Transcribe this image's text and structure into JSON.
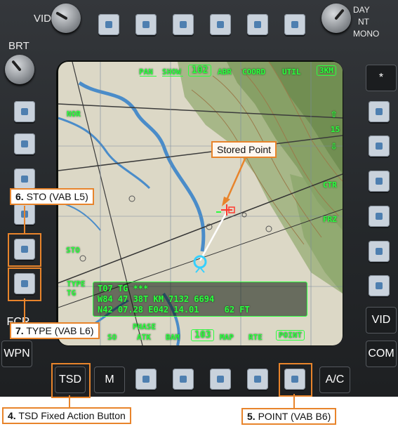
{
  "top_knobs": {
    "vid_label": "VID",
    "brt_label": "BRT",
    "day_label": "DAY",
    "nt_label": "NT",
    "mono_label": "MONO"
  },
  "top_labels": {
    "pan": "PAN",
    "show": "SHOW",
    "page_no": "102",
    "abr": "ABR",
    "coord": "COORD",
    "util": "UTIL",
    "scale": "3KM"
  },
  "right_labels": {
    "ctr": "CTR",
    "frz": "FRZ",
    "zoom_level": "15"
  },
  "left_labels": {
    "nor": "NOR",
    "sto": "STO",
    "type_line1": "TYPE",
    "type_line2": "TG"
  },
  "bottom_labels": {
    "so": "SO",
    "phase": "PHASE",
    "atk": "ATK",
    "bam": "BAM",
    "page_no": "103",
    "map": "MAP",
    "rte": "RTE",
    "point": "POINT"
  },
  "data_block": {
    "line1": "T07 TG ***",
    "line2": "W84 47 38T KM 7132 6694",
    "line3": "N42 07.28 E042 14.01     62 FT"
  },
  "fixed_buttons": {
    "star": "*",
    "vid": "VID",
    "com": "COM",
    "ac": "A/C",
    "tsd": "TSD",
    "m": "M",
    "fcr": "FCR",
    "wpn": "WPN"
  },
  "callouts": {
    "stored_point": "Stored Point",
    "sto_num": "6.",
    "sto_text": "STO (VAB L5)",
    "type_num": "7.",
    "type_text": "TYPE (VAB L6)",
    "tsd_num": "4.",
    "tsd_text": "TSD Fixed Action Button",
    "point_num": "5.",
    "point_text": "POINT (VAB B6)"
  },
  "colors": {
    "symbology": "#2bff3e",
    "callout_border": "#e8842b",
    "bezel": "#2a2d30"
  }
}
